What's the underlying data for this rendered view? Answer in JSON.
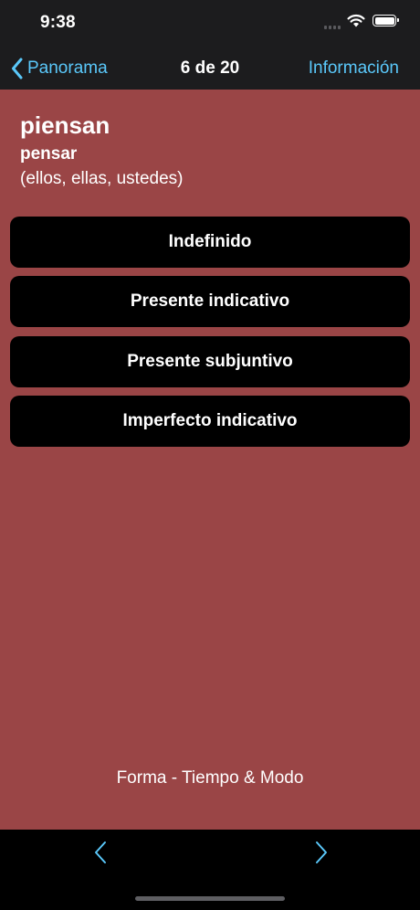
{
  "status_bar": {
    "time": "9:38"
  },
  "nav": {
    "back_label": "Panorama",
    "title": "6 de 20",
    "info_label": "Información"
  },
  "card": {
    "word": "piensan",
    "infinitive": "pensar",
    "pronouns": "(ellos, ellas, ustedes)"
  },
  "options": [
    {
      "label": "Indefinido"
    },
    {
      "label": "Presente indicativo"
    },
    {
      "label": "Presente subjuntivo"
    },
    {
      "label": "Imperfecto indicativo"
    }
  ],
  "footer": {
    "label": "Forma - Tiempo & Modo"
  },
  "colors": {
    "background": "#9a4546",
    "accent": "#5ac8fa",
    "button": "#000000"
  },
  "icons": {
    "back": "chevron-left-icon",
    "prev": "chevron-left-icon",
    "next": "chevron-right-icon"
  }
}
